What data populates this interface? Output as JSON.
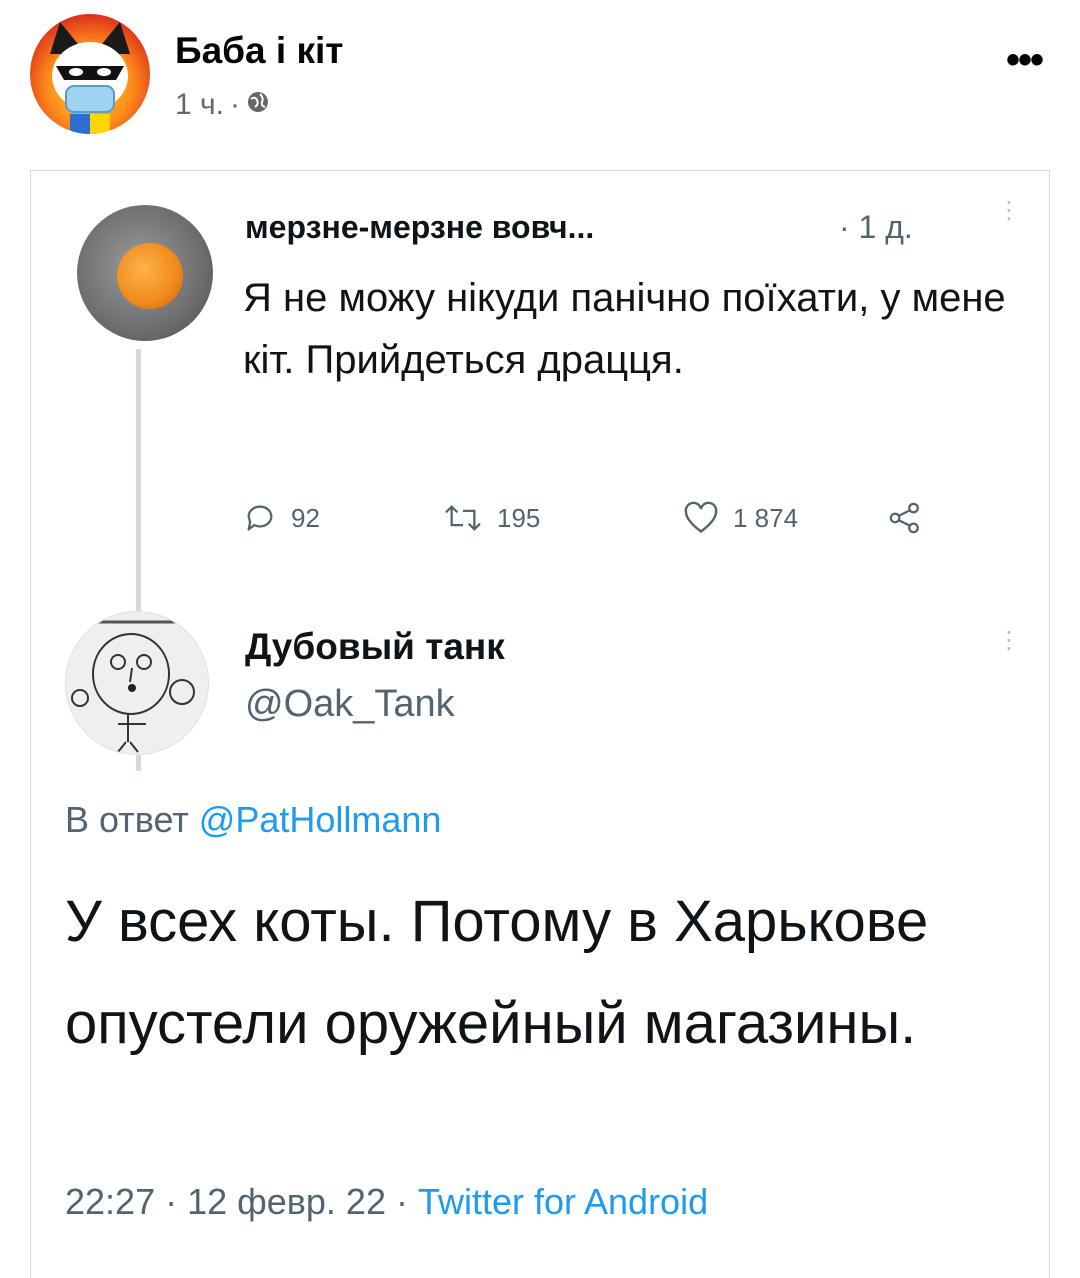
{
  "post": {
    "page_name": "Баба і кіт",
    "time": "1 ч.",
    "separator": "·",
    "audience_icon": "globe-icon",
    "more_label": "•••"
  },
  "tweet1": {
    "author": "мерзне-мерзне вовч...",
    "time": "· 1 д.",
    "text": "Я не можу нікуди панічно поїхати, у мене кіт. Прийдеться драцця.",
    "replies": "92",
    "retweets": "195",
    "likes": "1 874",
    "icons": [
      "reply-icon",
      "retweet-icon",
      "like-icon",
      "share-icon"
    ]
  },
  "tweet2": {
    "author": "Дубовый танк",
    "handle": "@Oak_Tank",
    "reply_prefix": "В ответ",
    "reply_to": "@PatHollmann",
    "text": "У всех коты. Потому в Харькове опустели оружейный магазины.",
    "timestamp": "22:27 · 12 февр. 22 ·",
    "client": "Twitter for Android"
  },
  "colors": {
    "link": "#1d9bf0",
    "secondary": "#536471",
    "thread_line": "#cfd9de"
  }
}
